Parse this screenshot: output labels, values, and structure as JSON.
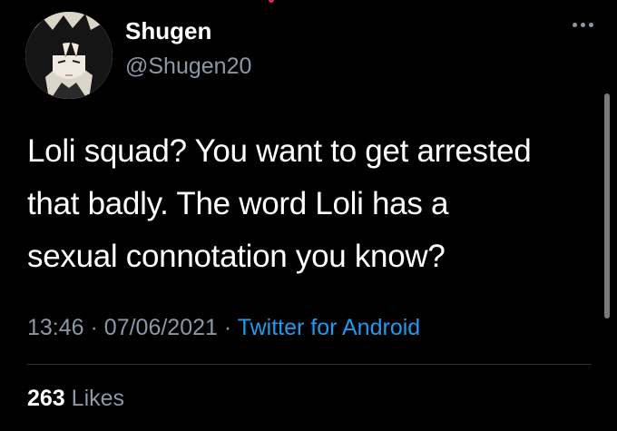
{
  "tweet": {
    "author": {
      "display_name": "Shugen",
      "handle": "@Shugen20"
    },
    "text_lines": [
      "Loli squad? You want to get arrested",
      "that badly. The word Loli has a",
      "sexual connotation you know?"
    ],
    "time": "13:46",
    "separator": "·",
    "date": "07/06/2021",
    "source": "Twitter for Android",
    "likes": {
      "count": "263",
      "label": "Likes"
    }
  },
  "icons": {
    "more": "more-horizontal-icon"
  },
  "colors": {
    "background": "#000000",
    "primary_text": "#ffffff",
    "secondary_text": "#8b98a5",
    "link": "#1d9bf0",
    "divider": "#2f3336"
  }
}
